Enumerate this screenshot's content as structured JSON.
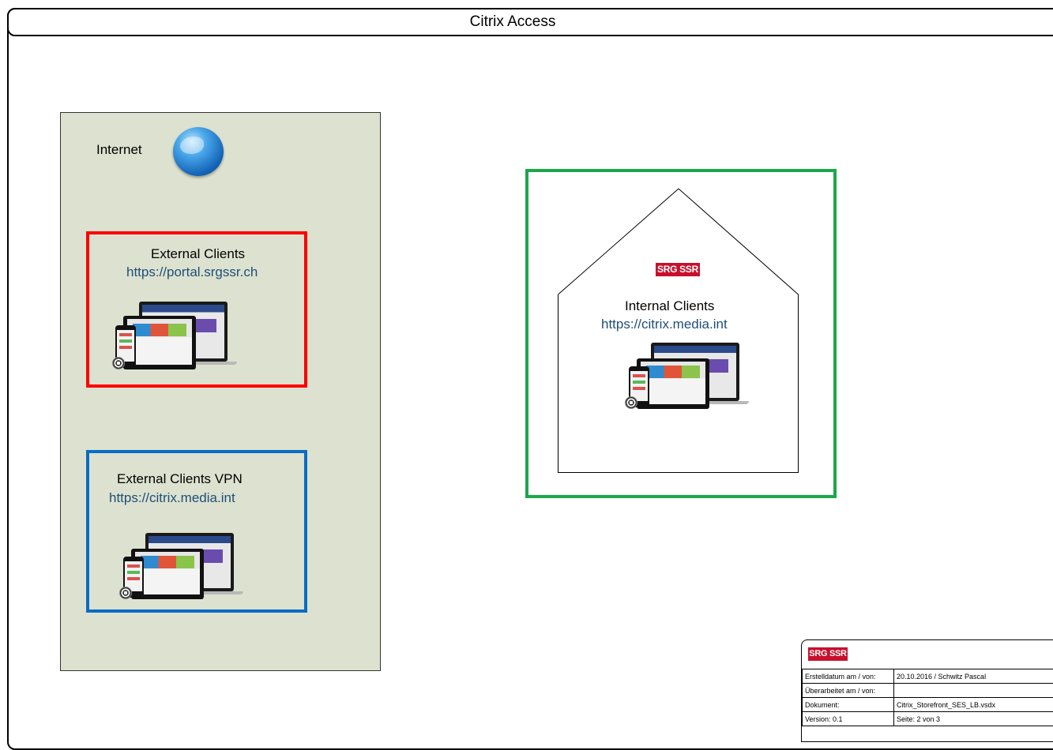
{
  "page": {
    "title": "Citrix Access"
  },
  "internet": {
    "label": "Internet",
    "icon": "globe-icon"
  },
  "external_clients": {
    "label": "External Clients",
    "url": "https://portal.srgssr.ch",
    "border_color": "#ff0000"
  },
  "external_clients_vpn": {
    "label": "External Clients VPN",
    "url": "https://citrix.media.int",
    "border_color": "#0b6cc4"
  },
  "internal_clients": {
    "label": "Internal Clients",
    "url": "https://citrix.media.int",
    "border_color": "#1ba84a",
    "logo_text": "SRG SSR"
  },
  "zone_colors": {
    "internet_zone": "#dce2cf"
  },
  "info_block": {
    "logo_text": "SRG SSR",
    "rows": [
      {
        "key": "Erstelldatum am / von:",
        "value": "20.10.2016 / Schwitz Pascal"
      },
      {
        "key": "Überarbeitet am / von:",
        "value": ""
      },
      {
        "key": "Dokument:",
        "value": "Citrix_Storefront_SES_LB.vsdx"
      },
      {
        "key": "Version:  0.1",
        "value": "Seite:  2  von  3"
      }
    ]
  }
}
